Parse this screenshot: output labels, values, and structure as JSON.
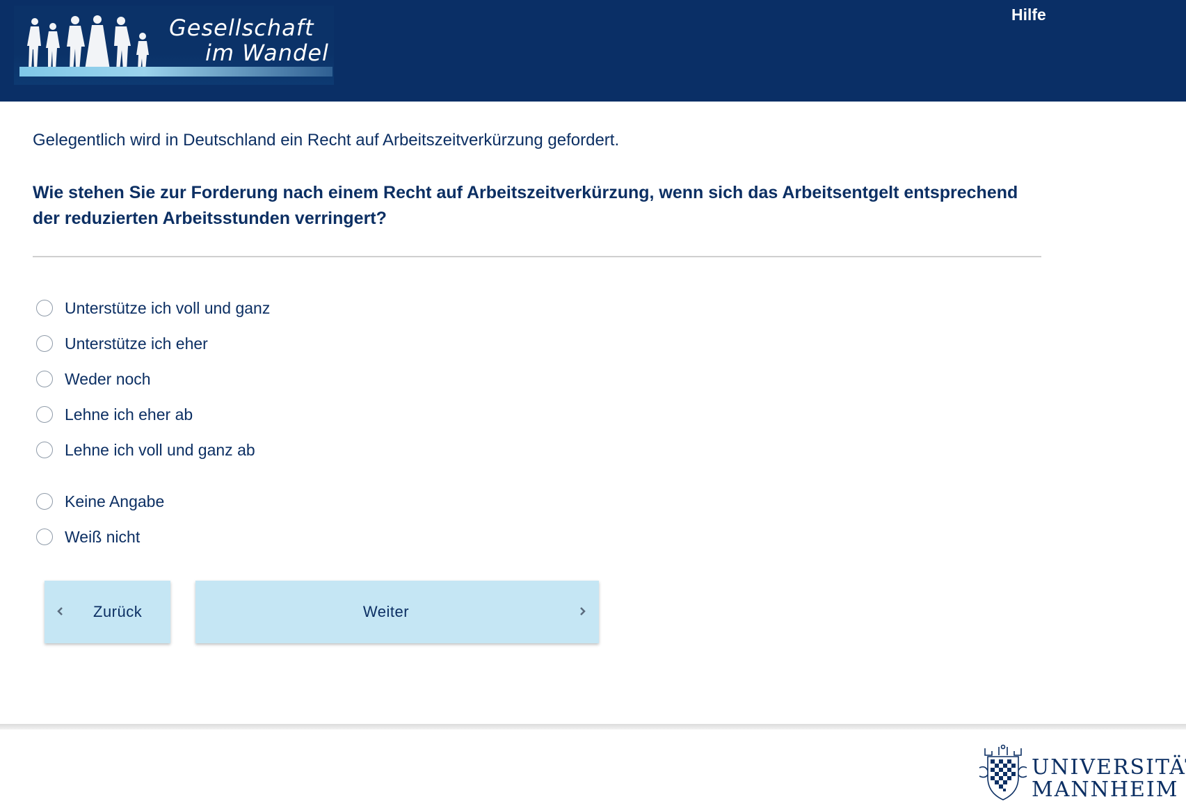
{
  "header": {
    "logo_line1": "Gesellschaft",
    "logo_line2": "im Wandel",
    "help": "Hilfe",
    "background": "#0a2f66"
  },
  "question": {
    "intro": "Gelegentlich wird in Deutschland ein Recht auf Arbeitszeitverkürzung gefordert.",
    "text": "Wie stehen Sie zur Forderung nach einem Recht auf Arbeitszeitverkürzung, wenn sich das Arbeitsentgelt entsprechend der reduzierten Arbeitsstunden verringert?"
  },
  "options": [
    {
      "label": "Unterstütze ich voll und ganz",
      "selected": false
    },
    {
      "label": "Unterstütze ich eher",
      "selected": false
    },
    {
      "label": "Weder noch",
      "selected": false
    },
    {
      "label": "Lehne ich eher ab",
      "selected": false
    },
    {
      "label": "Lehne ich voll und ganz ab",
      "selected": false
    },
    {
      "label": "Keine Angabe",
      "selected": false
    },
    {
      "label": "Weiß nicht",
      "selected": false
    }
  ],
  "nav": {
    "back": "Zurück",
    "next": "Weiter",
    "button_color": "#c5e6f4"
  },
  "footer": {
    "uni_line1": "UNIVERSITÄT",
    "uni_line2": "MANNHEIM"
  },
  "colors": {
    "text": "#0c2f63",
    "divider": "#cfcfcf"
  }
}
